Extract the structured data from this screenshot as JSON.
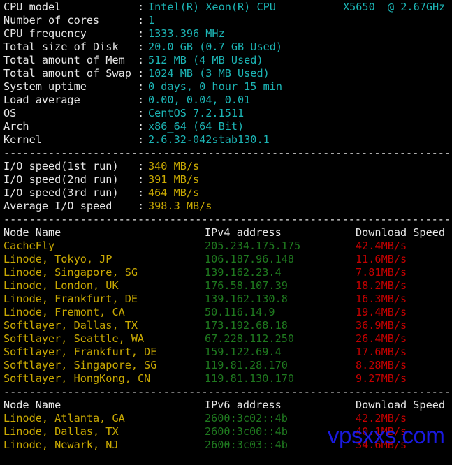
{
  "sysinfo": [
    {
      "label": "CPU model",
      "value": "Intel(R) Xeon(R) CPU",
      "value_extra": "X5650  @ 2.67GHz"
    },
    {
      "label": "Number of cores",
      "value": "1"
    },
    {
      "label": "CPU frequency",
      "value": "1333.396 MHz"
    },
    {
      "label": "Total size of Disk",
      "value": "20.0 GB (0.7 GB Used)"
    },
    {
      "label": "Total amount of Mem",
      "value": "512 MB (4 MB Used)"
    },
    {
      "label": "Total amount of Swap",
      "value": "1024 MB (3 MB Used)"
    },
    {
      "label": "System uptime",
      "value": "0 days, 0 hour 15 min"
    },
    {
      "label": "Load average",
      "value": "0.00, 0.04, 0.01"
    },
    {
      "label": "OS",
      "value": "CentOS 7.2.1511"
    },
    {
      "label": "Arch",
      "value": "x86_64 (64 Bit)"
    },
    {
      "label": "Kernel",
      "value": "2.6.32-042stab130.1"
    }
  ],
  "separator": "----------------------------------------------------------------------",
  "colon": ":",
  "io": [
    {
      "label": "I/O speed(1st run)",
      "value": "340 MB/s"
    },
    {
      "label": "I/O speed(2nd run)",
      "value": "391 MB/s"
    },
    {
      "label": "I/O speed(3rd run)",
      "value": "464 MB/s"
    },
    {
      "label": "Average I/O speed",
      "value": "398.3 MB/s"
    }
  ],
  "ipv4_table": {
    "headers": {
      "node": "Node Name",
      "address": "IPv4 address",
      "speed": "Download Speed"
    },
    "rows": [
      {
        "node": "CacheFly",
        "address": "205.234.175.175",
        "speed": "42.4MB/s"
      },
      {
        "node": "Linode, Tokyo, JP",
        "address": "106.187.96.148",
        "speed": "11.6MB/s"
      },
      {
        "node": "Linode, Singapore, SG",
        "address": "139.162.23.4",
        "speed": "7.81MB/s"
      },
      {
        "node": "Linode, London, UK",
        "address": "176.58.107.39",
        "speed": "18.2MB/s"
      },
      {
        "node": "Linode, Frankfurt, DE",
        "address": "139.162.130.8",
        "speed": "16.3MB/s"
      },
      {
        "node": "Linode, Fremont, CA",
        "address": "50.116.14.9",
        "speed": "19.4MB/s"
      },
      {
        "node": "Softlayer, Dallas, TX",
        "address": "173.192.68.18",
        "speed": "36.9MB/s"
      },
      {
        "node": "Softlayer, Seattle, WA",
        "address": "67.228.112.250",
        "speed": "26.4MB/s"
      },
      {
        "node": "Softlayer, Frankfurt, DE",
        "address": "159.122.69.4",
        "speed": "17.6MB/s"
      },
      {
        "node": "Softlayer, Singapore, SG",
        "address": "119.81.28.170",
        "speed": "8.28MB/s"
      },
      {
        "node": "Softlayer, HongKong, CN",
        "address": "119.81.130.170",
        "speed": "9.27MB/s"
      }
    ]
  },
  "ipv6_table": {
    "headers": {
      "node": "Node Name",
      "address": "IPv6 address",
      "speed": "Download Speed"
    },
    "rows": [
      {
        "node": "Linode, Atlanta, GA",
        "address": "2600:3c02::4b",
        "speed": "42.2MB/s"
      },
      {
        "node": "Linode, Dallas, TX",
        "address": "2600:3c00::4b",
        "speed": "40.1MB/s"
      },
      {
        "node": "Linode, Newark, NJ",
        "address": "2600:3c03::4b",
        "speed": "34.6MB/s"
      }
    ]
  },
  "watermark": "vpsxxs.com",
  "colors": {
    "label": "#e6e6e6",
    "sysinfo_value": "#1cb5b5",
    "io_value": "#c9a902",
    "node_name": "#c9a902",
    "address": "#1f7a1f",
    "speed": "#c40000",
    "watermark": "#1a1ae0"
  }
}
